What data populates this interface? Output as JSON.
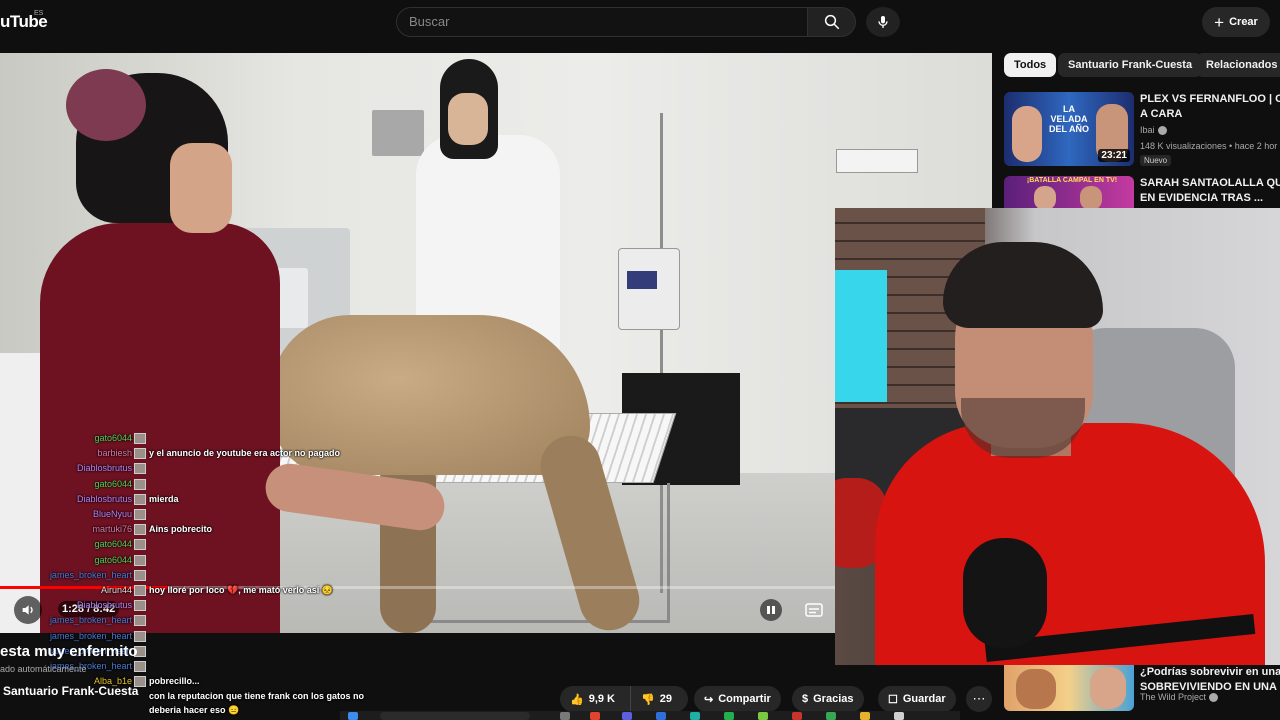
{
  "header": {
    "logo_text": "uTube",
    "logo_country": "ES",
    "search_placeholder": "Buscar",
    "create_label": "Crear"
  },
  "player": {
    "time": "1:28 / 8:42",
    "progress": 0.169
  },
  "chat": [
    {
      "user": "gato6044",
      "color": "#52d152",
      "message": ""
    },
    {
      "user": "barbiesh",
      "color": "#d77aa5",
      "message": "y el anuncio de youtube era actor no pagado"
    },
    {
      "user": "Diablosbrutus",
      "color": "#b583f2",
      "message": ""
    },
    {
      "user": "gato6044",
      "color": "#52d152",
      "message": ""
    },
    {
      "user": "Diablosbrutus",
      "color": "#b583f2",
      "message": "mierda"
    },
    {
      "user": "BlueNyuu",
      "color": "#b583f2",
      "message": ""
    },
    {
      "user": "martuki76",
      "color": "#d77aa5",
      "message": "Ains pobrecito"
    },
    {
      "user": "gato6044",
      "color": "#52d152",
      "message": ""
    },
    {
      "user": "gato6044",
      "color": "#52d152",
      "message": ""
    },
    {
      "user": "james_broken_heart",
      "color": "#4a78d6",
      "message": ""
    },
    {
      "user": "Airun44",
      "color": "#e0e0e0",
      "message": "hoy lloré por loco 💔, me mató verlo así 😣"
    },
    {
      "user": "Diablosbrutus",
      "color": "#b583f2",
      "message": ""
    },
    {
      "user": "james_broken_heart",
      "color": "#4a78d6",
      "message": ""
    },
    {
      "user": "james_broken_heart",
      "color": "#4a78d6",
      "message": ""
    },
    {
      "user": "james_broken_heart",
      "color": "#4a78d6",
      "message": ""
    },
    {
      "user": "james_broken_heart",
      "color": "#4a78d6",
      "message": ""
    },
    {
      "user": "Alba_b1e",
      "color": "#e6c02c",
      "message": "pobrecillo..."
    },
    {
      "user": "",
      "color": "#4ad1c9",
      "message": "con la reputacion que tiene frank con los gatos no deberia hacer eso 😑"
    }
  ],
  "video_info": {
    "title": "esta muy enfermito",
    "subline": "ado automáticamente",
    "channel": "Santuario Frank-Cuesta"
  },
  "actions": {
    "likes": "9,9 K",
    "dislikes": "29",
    "share": "Compartir",
    "thanks": "Gracias",
    "save": "Guardar"
  },
  "chips": [
    "Todos",
    "Santuario Frank-Cuesta",
    "Relacionados"
  ],
  "recommendations": [
    {
      "title_line1": "PLEX VS FERNANFLOO | CAR",
      "title_line2": "A CARA",
      "channel": "Ibai",
      "meta": "148 K visualizaciones • hace 2 hor",
      "badge": "Nuevo",
      "duration": "23:21",
      "thumb_text": "LA VELADA DEL AÑO"
    },
    {
      "title_line1": "SARAH SANTAOLALLA QUED",
      "title_line2": "EN EVIDENCIA TRAS ...",
      "thumb_text": "¡BATALLA CAMPAL EN TV!"
    },
    {
      "title_line1": "¿Podrías sobrevivir en una isla?",
      "title_line2": "SOBREVIVIENDO EN UNA ISL",
      "channel": "The Wild Project"
    }
  ],
  "colors": {
    "accent": "#ff0000",
    "background": "#0f0f0f",
    "chip_bg": "#272727"
  }
}
